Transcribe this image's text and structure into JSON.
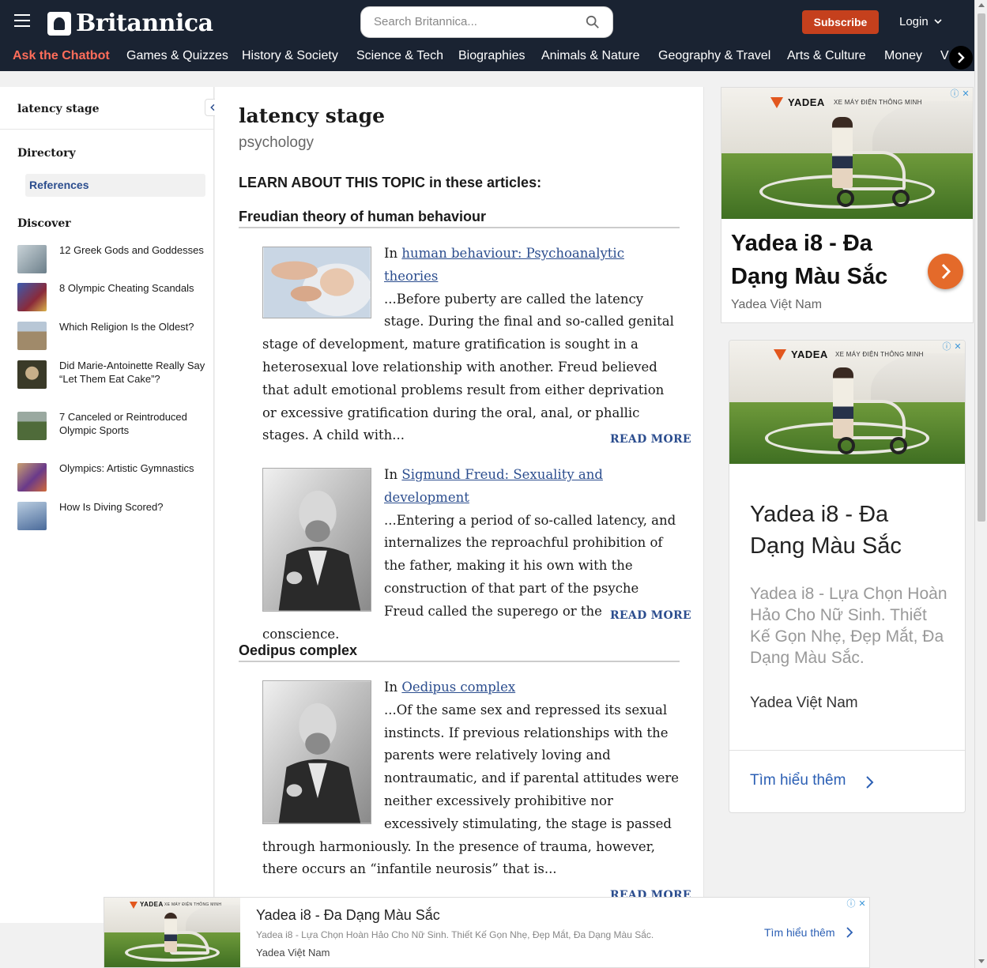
{
  "header": {
    "logo_text": "Britannica",
    "search_placeholder": "Search Britannica...",
    "subscribe_label": "Subscribe",
    "login_label": "Login",
    "nav": [
      "Ask the Chatbot",
      "Games & Quizzes",
      "History & Society",
      "Science & Tech",
      "Biographies",
      "Animals & Nature",
      "Geography & Travel",
      "Arts & Culture",
      "Money",
      "V"
    ]
  },
  "sidebar": {
    "title": "latency stage",
    "directory_heading": "Directory",
    "references_label": "References",
    "discover_heading": "Discover",
    "discover": [
      {
        "label": "12 Greek Gods and Goddesses",
        "color": "#8a9aa6"
      },
      {
        "label": "8 Olympic Cheating Scandals",
        "color": "#2f4d8a"
      },
      {
        "label": "Which Religion Is the Oldest?",
        "color": "#9b8a72"
      },
      {
        "label": "Did Marie-Antoinette Really Say “Let Them Eat Cake”?",
        "color": "#4a4a36"
      },
      {
        "label": "7 Canceled or Reintroduced Olympic Sports",
        "color": "#5a6e3e"
      },
      {
        "label": "Olympics: Artistic Gymnastics",
        "color": "#7a4a6a"
      },
      {
        "label": "How Is Diving Scored?",
        "color": "#5a7aa0"
      }
    ]
  },
  "article": {
    "title": "latency stage",
    "subtitle": "psychology",
    "learn_prefix": "LEARN ABOUT THIS TOPIC",
    "learn_suffix": " in these articles:",
    "read_more": "READ MORE",
    "sections": [
      {
        "heading": "Freudian theory of human behaviour",
        "excerpts": [
          {
            "in": "In ",
            "link": "human behaviour: Psychoanalytic theories",
            "text": "...Before puberty are called the latency stage. During the final and so-called genital stage of development, mature gratification is sought in a heterosexual love relationship with another. Freud believed that adult emotional problems result from either deprivation or excessive gratification during the oral, anal, or phallic stages. A child with..."
          },
          {
            "in": "In ",
            "link": "Sigmund Freud: Sexuality and development",
            "text": "...Entering a period of so-called latency, and internalizes the reproachful prohibition of the father, making it his own with the construction of that part of the psyche Freud called the superego or the conscience."
          }
        ]
      },
      {
        "heading": "Oedipus complex",
        "excerpts": [
          {
            "in": "In ",
            "link": "Oedipus complex",
            "text": "...Of the same sex and repressed its sexual instincts. If previous relationships with the parents were relatively loving and nontraumatic, and if parental attitudes were neither excessively prohibitive nor excessively stimulating, the stage is passed through harmoniously. In the presence of trauma, however, there occurs an “infantile neurosis” that is..."
          }
        ]
      }
    ]
  },
  "ads": {
    "brand": "YADEA",
    "brand_tag": "XE MÁY ĐIỆN THÔNG MINH",
    "headline": "Yadea i8 - Đa Dạng Màu Sắc",
    "body": "Yadea i8 - Lựa Chọn Hoàn Hảo Cho Nữ Sinh. Thiết Kế Gọn Nhẹ, Đẹp Mắt, Đa Dạng Màu Sắc.",
    "source": "Yadea Việt Nam",
    "cta": "Tìm hiểu thêm",
    "accent": "#e46a2a"
  },
  "colors": {
    "header_bg": "#1a2332",
    "chatbot": "#ff6d5a",
    "subscribe": "#c5401d",
    "link": "#2b4d8e"
  }
}
